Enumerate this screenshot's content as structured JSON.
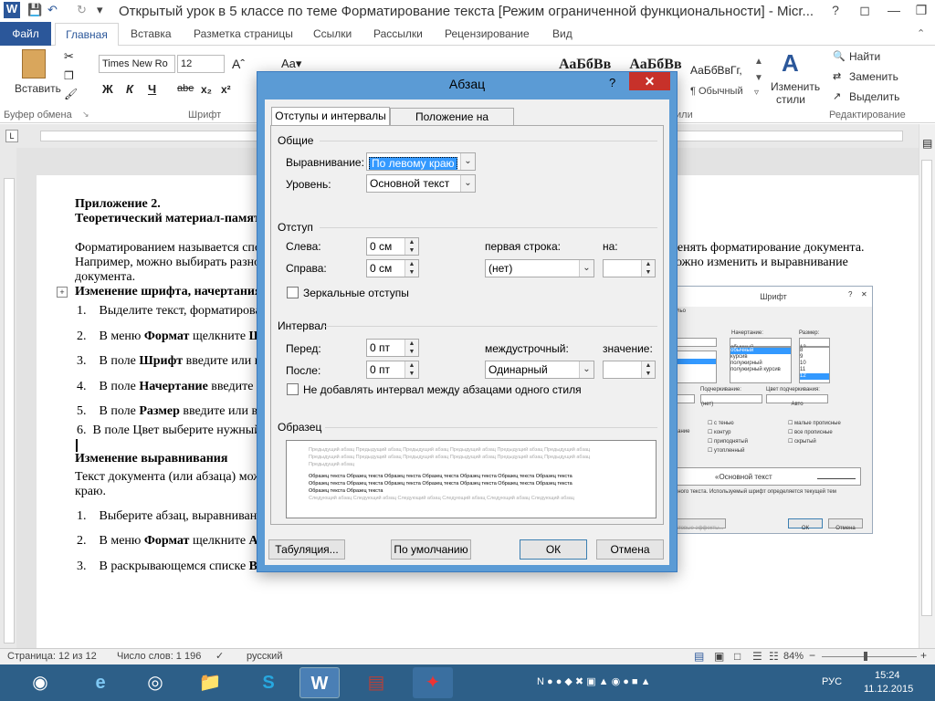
{
  "window": {
    "title": "Открытый урок в 5 классе по теме Форматирование текста [Режим ограниченной функциональности]  -  Micr..."
  },
  "ribbon": {
    "tabs": [
      "Файл",
      "Главная",
      "Вставка",
      "Разметка страницы",
      "Ссылки",
      "Рассылки",
      "Рецензирование",
      "Вид"
    ],
    "font_name": "Times New Ro",
    "font_size": "12",
    "paste_label": "Вставить",
    "group_clipboard": "Буфер обмена",
    "group_font": "Шрифт",
    "group_styles_tail": "или",
    "group_editing": "Редактирование",
    "styles": [
      "АаБбВв",
      "АаБбВв",
      "АаБбВвГг,"
    ],
    "style_normal": "¶ Обычный",
    "change_styles": [
      "Изменить",
      "стили"
    ],
    "find": "Найти",
    "replace": "Заменить",
    "select": "Выделить",
    "fmt_buttons": [
      "Ж",
      "К",
      "Ч",
      "abe",
      "x₂",
      "x²"
    ]
  },
  "document": {
    "lines": [
      "Приложение 2.",
      "Теоретический материал-памят",
      "Форматированием называется спо",
      "Например, можно выбирать разно",
      "документа.",
      "Изменение шрифта, начертания",
      "Изменение выравнивания",
      "Текст документа (или абзаца) мож",
      "краю."
    ],
    "right_lines": [
      "менять форматирование документа.",
      "ложно изменить и выравнивание"
    ],
    "list1": [
      {
        "n": "1.",
        "pre": "Выделите текст, форматирова",
        "b": ""
      },
      {
        "n": "2.",
        "pre": "В меню ",
        "b": "Формат",
        "post": " щелкните ",
        "b2": "Ш"
      },
      {
        "n": "3.",
        "pre": "В поле ",
        "b": "Шрифт",
        "post": " введите или вы"
      },
      {
        "n": "4.",
        "pre": "В поле ",
        "b": "Начертание",
        "post": " введите и"
      },
      {
        "n": "5.",
        "pre": "В поле ",
        "b": "Размер",
        "post": " введите или вы"
      },
      {
        "n": "6.",
        "pre": "В поле Цвет выберите нужный",
        "b": ""
      }
    ],
    "list2": [
      {
        "n": "1.",
        "pre": "Выберите абзац, выравнивани"
      },
      {
        "n": "2.",
        "pre": "В меню ",
        "b": "Формат",
        "post": " щелкните ",
        "b2": "Аб"
      },
      {
        "n": "3.",
        "pre": "В раскрывающемся списке ",
        "b": "Вы"
      }
    ]
  },
  "font_dialog_bg": {
    "title": "Шрифт",
    "tab": "льо",
    "style_label": "Начертание:",
    "size_label": "Размер:",
    "styles": [
      "обычный",
      "обычный",
      "курсив",
      "полужирный",
      "полужирный курсив"
    ],
    "sizes": [
      "12",
      "8",
      "9",
      "10",
      "11",
      "12"
    ],
    "underline_label": "Подчеркивание:",
    "underline_color_label": "Цвет подчеркивания:",
    "underline_value": "(нет)",
    "color_value": "Авто",
    "effects_left": [
      "с тенью",
      "контур",
      "приподнятый",
      "утопленный"
    ],
    "effects_right": [
      "малые прописные",
      "все прописные",
      "скрытый"
    ],
    "align_tail": "вание",
    "preview_text": "«Основной текст",
    "note": "вного текста. Используемый шрифт определяется текущей тем",
    "effects_btn": "стовые эффекты...",
    "ok": "ОК",
    "cancel": "Отмена"
  },
  "dialog": {
    "title": "Абзац",
    "help": "?",
    "tabs": [
      "Отступы и интервалы",
      "Положение на странице"
    ],
    "general": "Общие",
    "alignment_label": "Выравнивание:",
    "alignment_value": "По левому краю",
    "level_label": "Уровень:",
    "level_value": "Основной текст",
    "indent": "Отступ",
    "left_label": "Слева:",
    "left_value": "0 см",
    "right_label": "Справа:",
    "right_value": "0 см",
    "first_line_label": "первая строка:",
    "first_line_value": "(нет)",
    "by_label": "на:",
    "by_value": "",
    "mirror_label": "Зеркальные отступы",
    "spacing": "Интервал",
    "before_label": "Перед:",
    "before_value": "0 пт",
    "after_label": "После:",
    "after_value": "0 пт",
    "line_spacing_label": "междустрочный:",
    "line_spacing_value": "Одинарный",
    "at_label": "значение:",
    "at_value": "",
    "no_space_label": "Не добавлять интервал между абзацами одного стиля",
    "preview": "Образец",
    "preview_prev": "Предыдущий абзац Предыдущий абзац Предыдущий абзац Предыдущий абзац Предыдущий абзац Предыдущий абзац",
    "preview_prev2": "Предыдущий абзац Предыдущий абзац Предыдущий абзац Предыдущий абзац Предыдущий абзац Предыдущий абзац",
    "preview_prev3": "Предыдущий абзац",
    "preview_sample": "Образец текста Образец текста Образец текста Образец текста Образец текста Образец текста Образец текста",
    "preview_sample_last": "Образец текста Образец текста",
    "preview_next": "Следующий абзац Следующий абзац Следующий абзац Следующий абзац Следующий абзац Следующий абзац",
    "tabs_button": "Табуляция...",
    "default_button": "По умолчанию",
    "ok_button": "ОК",
    "cancel_button": "Отмена"
  },
  "statusbar": {
    "page": "Страница: 12 из 12",
    "words": "Число слов: 1 196",
    "language": "русский",
    "zoom": "84%"
  },
  "taskbar": {
    "lang": "РУС",
    "time": "15:24",
    "date": "11.12.2015"
  }
}
